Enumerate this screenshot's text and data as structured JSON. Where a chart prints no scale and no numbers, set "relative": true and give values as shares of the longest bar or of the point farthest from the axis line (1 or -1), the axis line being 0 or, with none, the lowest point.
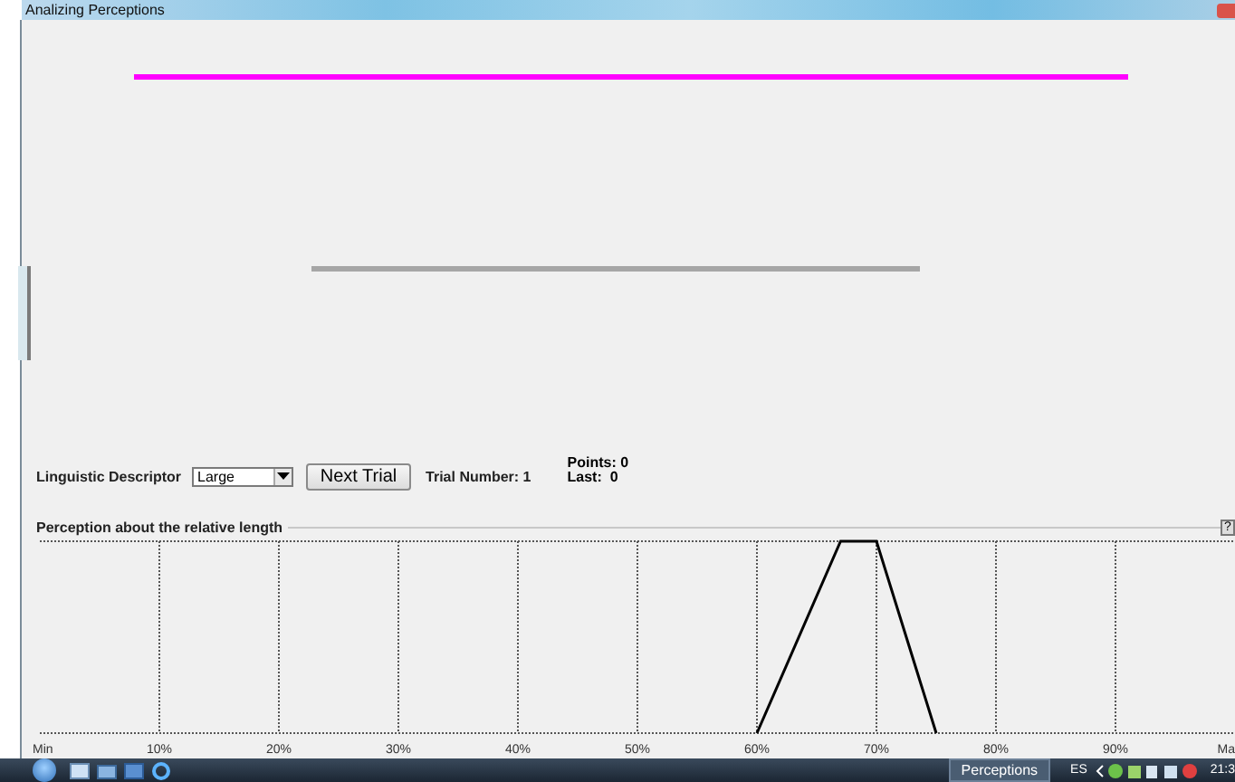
{
  "window": {
    "title": "Analizing Perceptions"
  },
  "stimulus_lines": [
    {
      "kind": "reference",
      "color": "#ff00ff"
    },
    {
      "kind": "stimulus",
      "color": "#a6a6a6"
    }
  ],
  "controls": {
    "descriptor_label": "Linguistic Descriptor",
    "descriptor_value": "Large",
    "next_button": "Next Trial",
    "trial_number": "Trial Number: 1",
    "points": "Points: 0",
    "last": "Last:  0"
  },
  "perception": {
    "title": "Perception about the relative length",
    "help": "?",
    "chart_data": {
      "type": "line",
      "x": [
        60,
        67,
        70,
        75
      ],
      "series": [
        {
          "color": "#000000",
          "values": [
            0,
            1,
            1,
            0
          ]
        }
      ],
      "relative": true,
      "grid": true,
      "xlim": [
        0,
        100
      ],
      "xticks": [
        {
          "value": 0,
          "label": "Min"
        },
        {
          "value": 10,
          "label": "10%"
        },
        {
          "value": 20,
          "label": "20%"
        },
        {
          "value": 30,
          "label": "30%"
        },
        {
          "value": 40,
          "label": "40%"
        },
        {
          "value": 50,
          "label": "50%"
        },
        {
          "value": 60,
          "label": "60%"
        },
        {
          "value": 70,
          "label": "70%"
        },
        {
          "value": 80,
          "label": "80%"
        },
        {
          "value": 90,
          "label": "90%"
        },
        {
          "value": 100,
          "label": "Ma"
        }
      ]
    }
  },
  "taskbar": {
    "task": "Perceptions",
    "language": "ES",
    "clock": "21:3"
  }
}
